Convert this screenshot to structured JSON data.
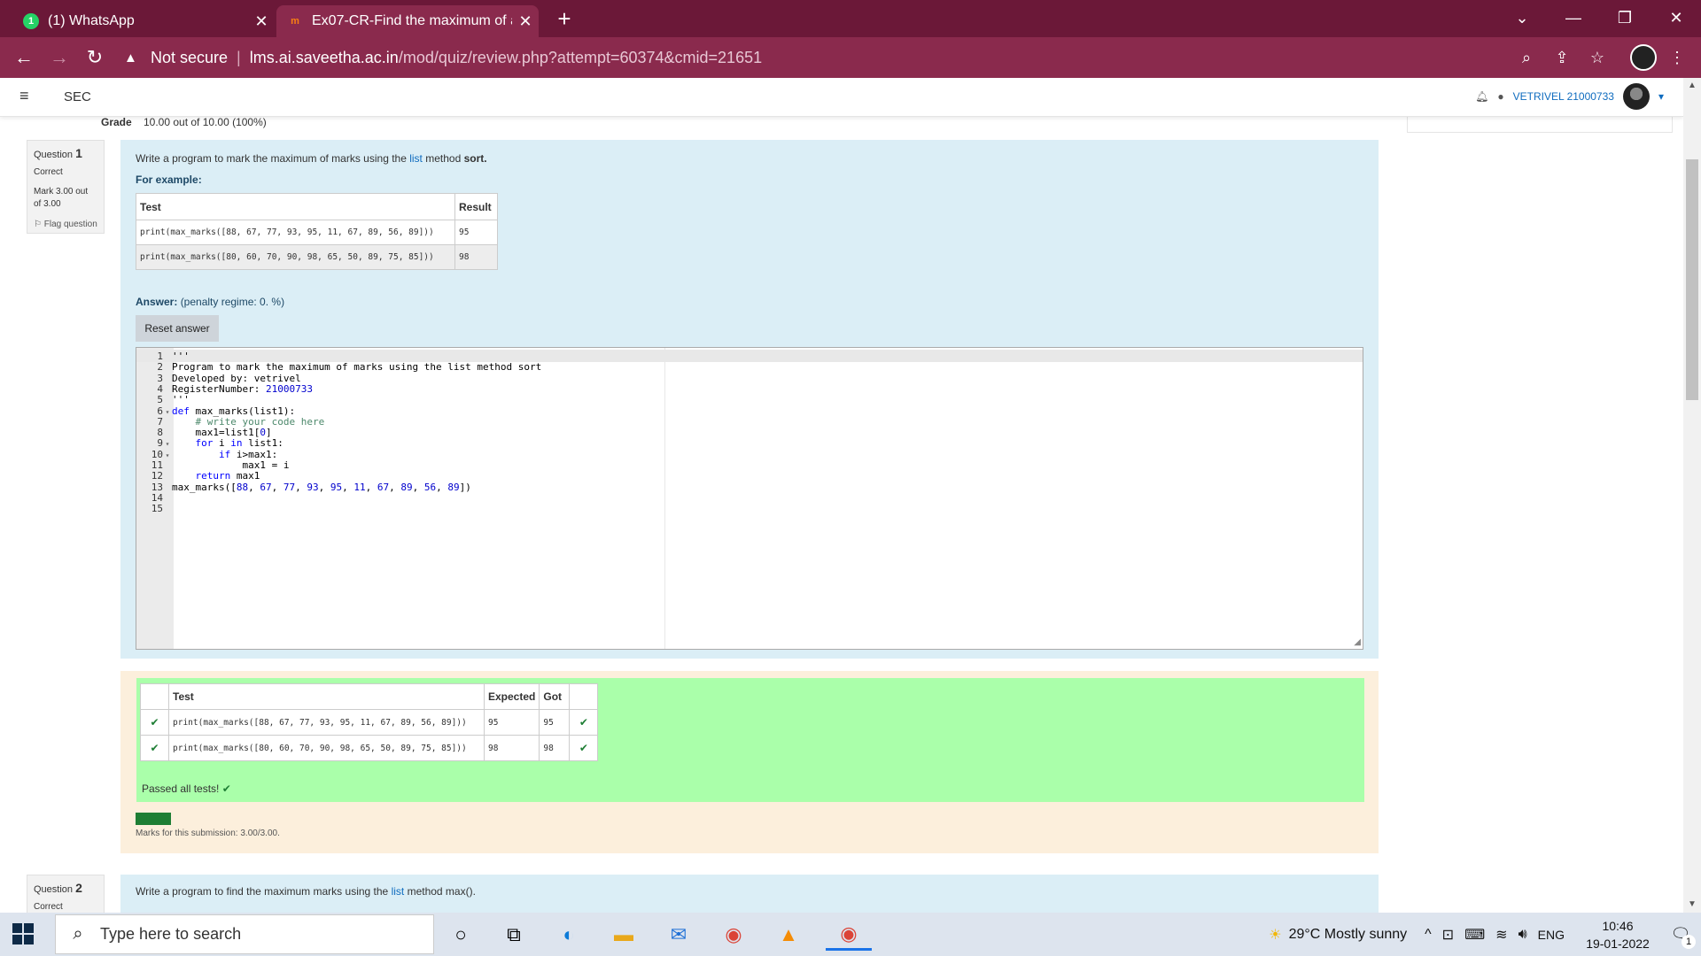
{
  "browser": {
    "tabs": [
      {
        "title": "(1) WhatsApp",
        "icon": "whatsapp-icon",
        "color": "#25d366"
      },
      {
        "title": "Ex07-CR-Find the maximum of a",
        "icon": "moodle-icon",
        "color": "#f98012"
      }
    ],
    "security_label": "Not secure",
    "url_host": "lms.ai.saveetha.ac.in",
    "url_path": "/mod/quiz/review.php?attempt=60374&cmid=21651",
    "accent": "#6b1838"
  },
  "moodle": {
    "site_name": "SEC",
    "user_name": "VETRIVEL 21000733",
    "grade_label": "Grade",
    "grade_value": "10.00 out of 10.00 (100%)"
  },
  "question1": {
    "label": "Question",
    "number": "1",
    "state": "Correct",
    "mark": "Mark 3.00 out of 3.00",
    "flag": "Flag question",
    "text_pre": "Write a program to mark the maximum of marks using the ",
    "text_link": "list",
    "text_mid": " method ",
    "text_bold": "sort.",
    "example_label": "For example:",
    "example_headers": [
      "Test",
      "Result"
    ],
    "examples": [
      [
        "print(max_marks([88, 67, 77, 93, 95, 11, 67, 89, 56, 89]))",
        "95"
      ],
      [
        "print(max_marks([80, 60, 70, 90, 98, 65, 50, 89, 75, 85]))",
        "98"
      ]
    ],
    "answer_label": "Answer:",
    "penalty": "(penalty regime: 0. %)",
    "reset_button": "Reset answer",
    "code_lines": [
      "'''",
      "Program to mark the maximum of marks using the list method sort",
      "Developed by: vetrivel",
      "RegisterNumber: 21000733",
      "'''",
      "def max_marks(list1):",
      "    # write your code here",
      "    max1=list1[0]",
      "    for i in list1:",
      "        if i>max1:",
      "            max1 = i",
      "    return max1",
      "max_marks([88, 67, 77, 93, 95, 11, 67, 89, 56, 89])",
      "",
      ""
    ],
    "result_headers": [
      "Test",
      "Expected",
      "Got"
    ],
    "results": [
      [
        "print(max_marks([88, 67, 77, 93, 95, 11, 67, 89, 56, 89]))",
        "95",
        "95"
      ],
      [
        "print(max_marks([80, 60, 70, 90, 98, 65, 50, 89, 75, 85]))",
        "98",
        "98"
      ]
    ],
    "passed": "Passed all tests!",
    "status_badge": "Correct",
    "marks_submission": "Marks for this submission: 3.00/3.00."
  },
  "question2": {
    "label": "Question",
    "number": "2",
    "state": "Correct",
    "text_pre": "Write a program to find the maximum marks using the ",
    "text_link": "list",
    "text_post": " method max()."
  },
  "taskbar": {
    "search_placeholder": "Type here to search",
    "weather": "29°C  Mostly sunny",
    "language": "ENG",
    "time": "10:46",
    "date": "19-01-2022",
    "notifications": "1"
  }
}
